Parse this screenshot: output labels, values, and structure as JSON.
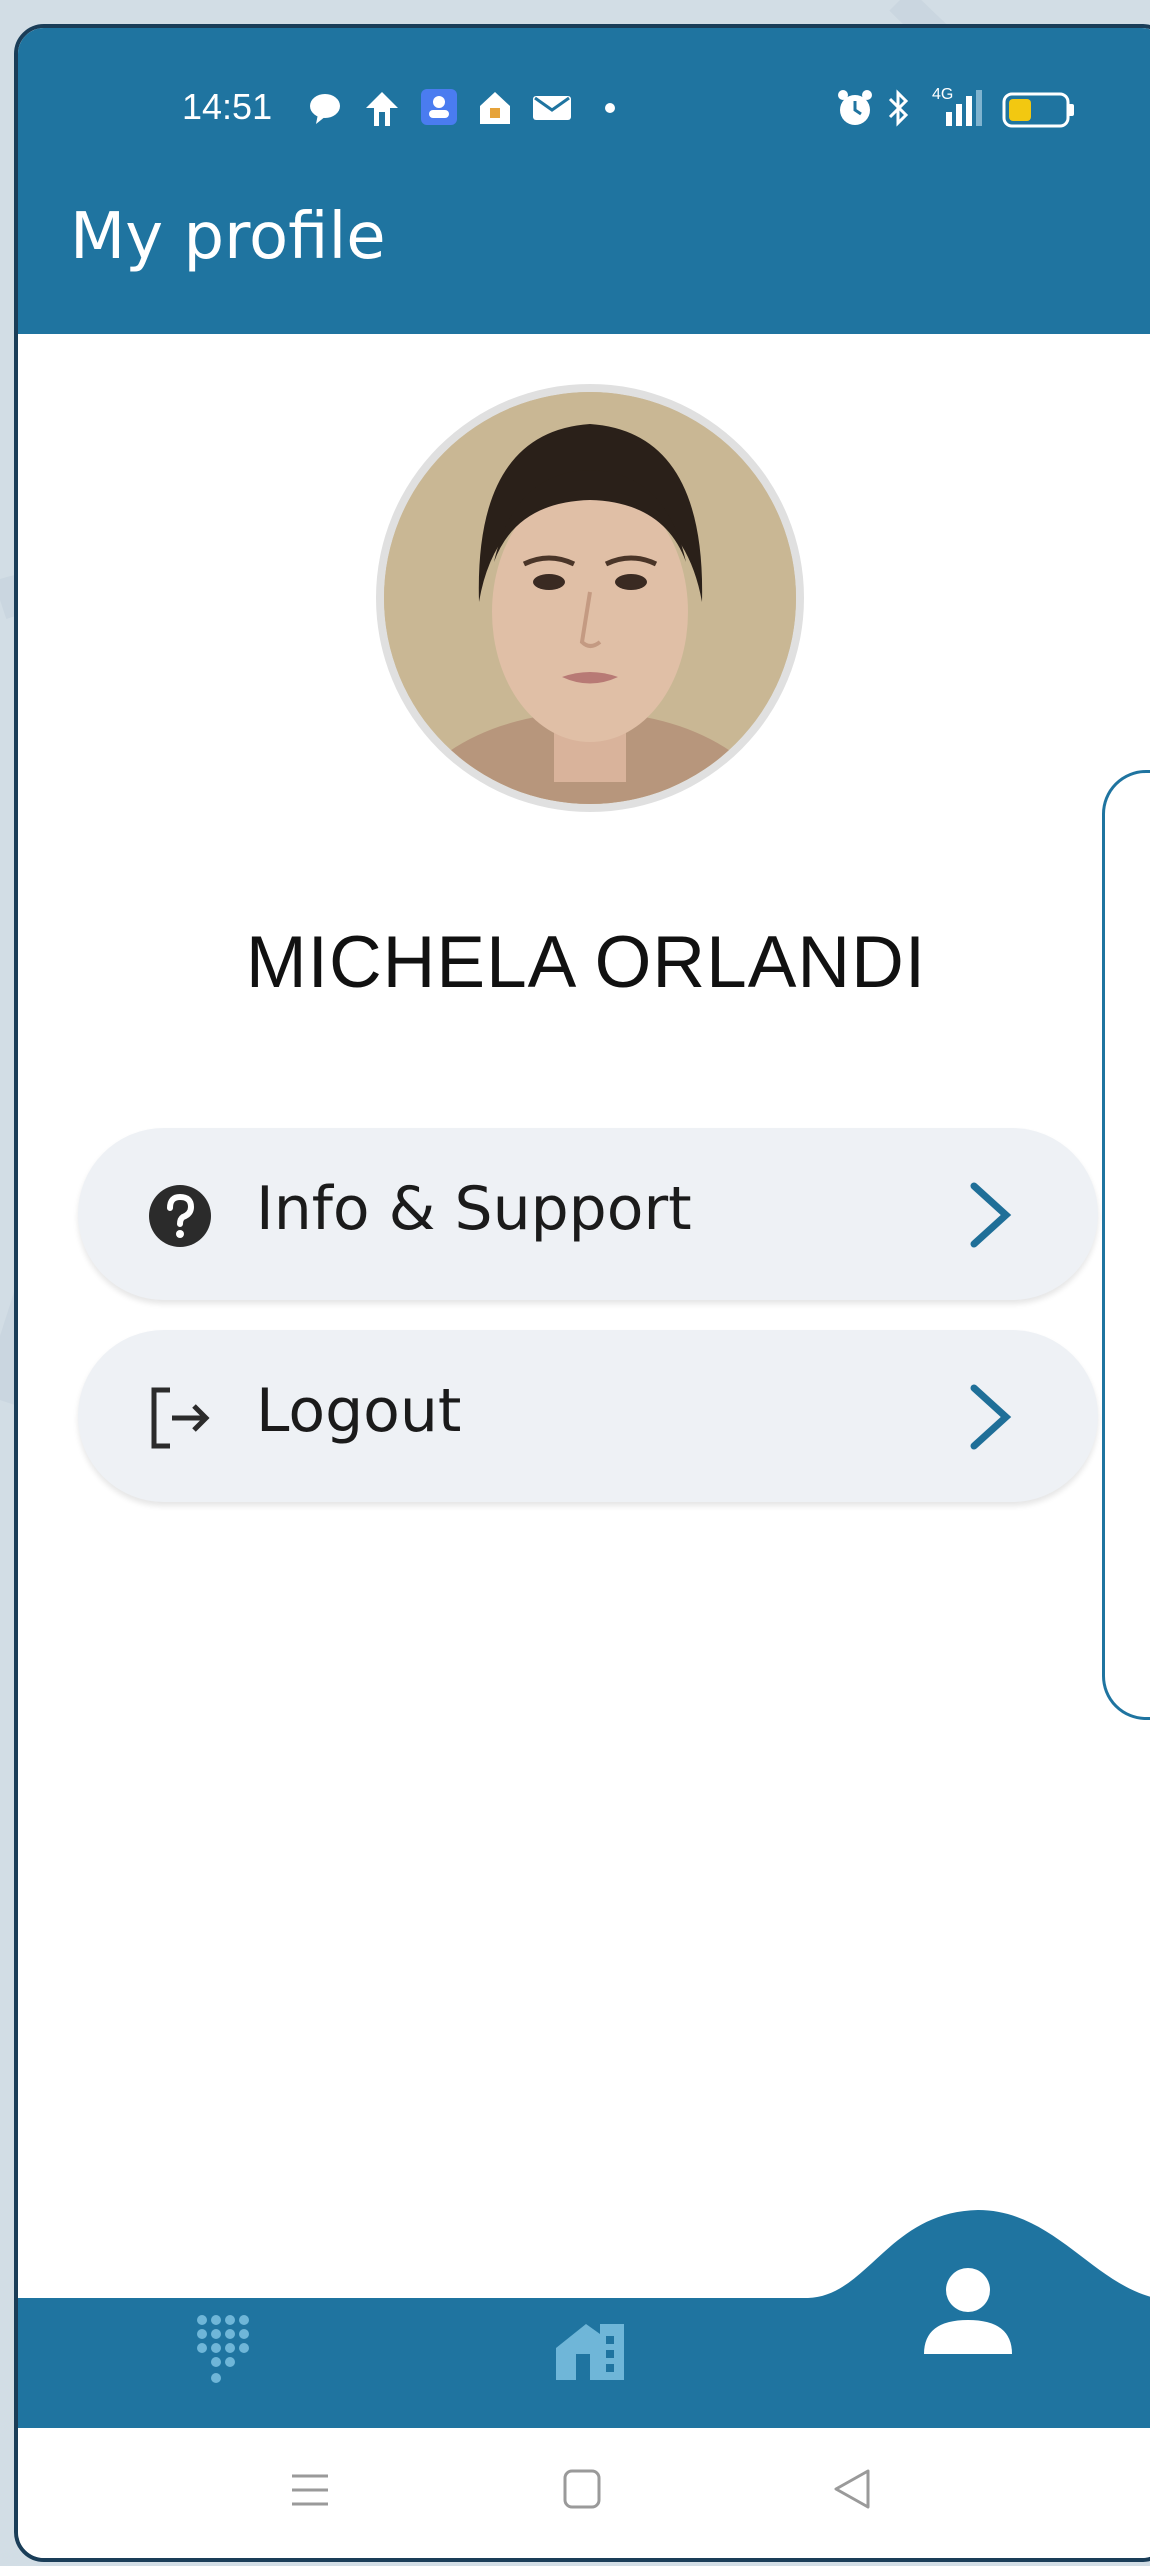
{
  "status_bar": {
    "time": "14:51",
    "network_label": "4G"
  },
  "header": {
    "title": "My profile"
  },
  "profile": {
    "name": "MICHELA ORLANDI"
  },
  "menu": [
    {
      "label": "Info & Support",
      "icon": "help-circle-icon",
      "chevron": "chevron-right-icon"
    },
    {
      "label": "Logout",
      "icon": "logout-icon",
      "chevron": "chevron-right-icon"
    }
  ],
  "bottom_nav": [
    {
      "name": "dialpad",
      "icon": "dialpad-icon",
      "active": false
    },
    {
      "name": "home",
      "icon": "home-icon",
      "active": false
    },
    {
      "name": "profile",
      "icon": "person-icon",
      "active": true
    }
  ],
  "system_nav": [
    "menu-icon",
    "home-square-icon",
    "back-triangle-icon"
  ],
  "colors": {
    "primary": "#1f74a0",
    "menu_bg": "#eef1f5",
    "chevron": "#1f6f98",
    "text": "#1b1b1b"
  }
}
